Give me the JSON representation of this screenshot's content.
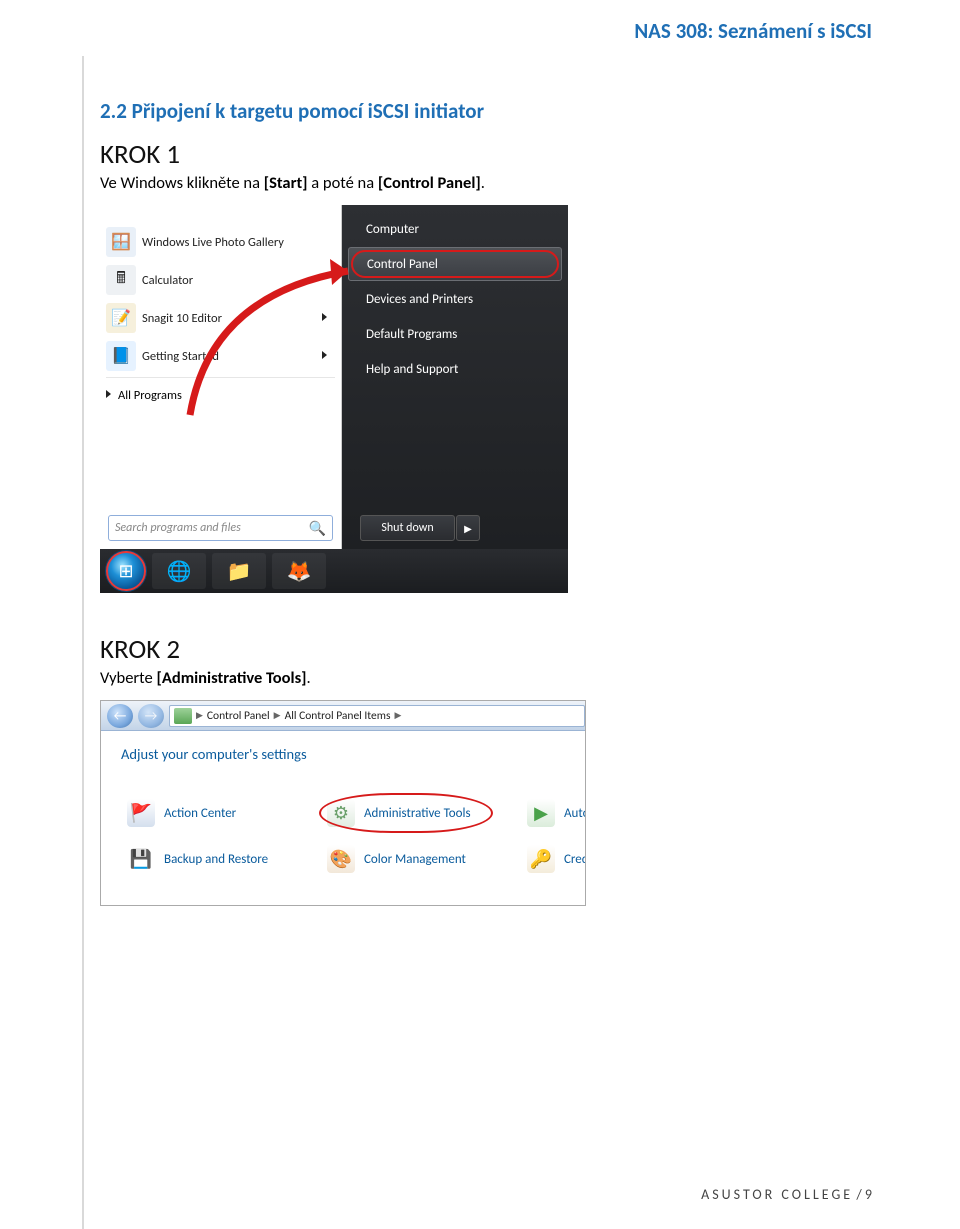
{
  "header_title": "NAS 308: Seznámení s iSCSI",
  "section_title": "2.2 Připojení k targetu pomocí iSCSI initiator",
  "krok1": {
    "title": "KROK 1",
    "text_pre": "Ve Windows klikněte na ",
    "start": "[Start]",
    "text_mid": " a poté na ",
    "cp": "[Control Panel]",
    "text_post": "."
  },
  "start_menu": {
    "left_items": [
      {
        "label": "",
        "icon": "",
        "no_text": true
      },
      {
        "label": "Windows Live Photo Gallery",
        "icon": "🪟",
        "bg": "#e9f0f8"
      },
      {
        "label": "Calculator",
        "icon": "🖩",
        "bg": "#eef1f4"
      },
      {
        "label": "Snagit 10 Editor",
        "icon": "📝",
        "bg": "#f6f0dc",
        "submenu": true
      },
      {
        "label": "Getting Started",
        "icon": "📘",
        "bg": "#e6f2ff",
        "submenu": true
      }
    ],
    "all_programs": "All Programs",
    "search_placeholder": "Search programs and files",
    "right_items": [
      {
        "label": "Computer"
      },
      {
        "label": "Control Panel",
        "highlight": true
      },
      {
        "label": "Devices and Printers"
      },
      {
        "label": "Default Programs"
      },
      {
        "label": "Help and Support"
      }
    ],
    "shutdown": "Shut down"
  },
  "krok2": {
    "title": "KROK 2",
    "text_pre": "Vyberte ",
    "admin": "[Administrative Tools]",
    "text_post": "."
  },
  "control_panel": {
    "breadcrumb": [
      "Control Panel",
      "All Control Panel Items"
    ],
    "adjust": "Adjust your computer's settings",
    "items_row1": [
      {
        "label": "Action Center",
        "icon": "🚩",
        "color": "#2a5fa8"
      },
      {
        "label": "Administrative Tools",
        "icon": "⚙",
        "color": "#6aa06a",
        "highlight": true
      },
      {
        "label": "AutoPl",
        "icon": "▶",
        "color": "#4aa24a",
        "partial": true
      }
    ],
    "items_row2": [
      {
        "label": "Backup and Restore",
        "icon": "💾",
        "color": "#888"
      },
      {
        "label": "Color Management",
        "icon": "🎨",
        "color": "#c08a40"
      },
      {
        "label": "Crede",
        "icon": "🔑",
        "color": "#c8a04a",
        "partial": true
      }
    ]
  },
  "footer_college": "ASUSTOR COLLEGE",
  "footer_page": " / 9"
}
